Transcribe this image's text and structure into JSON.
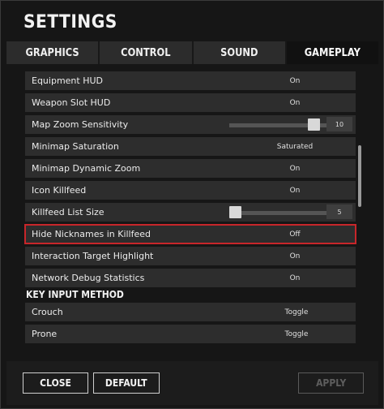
{
  "window": {
    "title": "SETTINGS"
  },
  "tabs": [
    {
      "label": "GRAPHICS",
      "active": false
    },
    {
      "label": "CONTROL",
      "active": false
    },
    {
      "label": "SOUND",
      "active": false
    },
    {
      "label": "GAMEPLAY",
      "active": true
    }
  ],
  "gameplay_settings": [
    {
      "label": "Equipment HUD",
      "value": "On"
    },
    {
      "label": "Weapon Slot HUD",
      "value": "On"
    },
    {
      "label": "Map Zoom Sensitivity",
      "value": "10",
      "slider_fraction": 0.92
    },
    {
      "label": "Minimap Saturation",
      "value": "Saturated"
    },
    {
      "label": "Minimap Dynamic Zoom",
      "value": "On"
    },
    {
      "label": "Icon Killfeed",
      "value": "On"
    },
    {
      "label": "Killfeed List Size",
      "value": "5",
      "slider_fraction": 0.0
    },
    {
      "label": "Hide Nicknames in Killfeed",
      "value": "Off",
      "highlighted": true
    },
    {
      "label": "Interaction Target Highlight",
      "value": "On"
    },
    {
      "label": "Network Debug Statistics",
      "value": "On"
    }
  ],
  "key_input_section": {
    "header": "KEY INPUT METHOD",
    "items": [
      {
        "label": "Crouch",
        "value": "Toggle"
      },
      {
        "label": "Prone",
        "value": "Toggle"
      }
    ]
  },
  "footer": {
    "close_label": "CLOSE",
    "default_label": "DEFAULT",
    "apply_label": "APPLY",
    "apply_enabled": false
  },
  "colors": {
    "highlight_border": "#c8262a",
    "row_background": "#2d2d2d",
    "active_tab": "#111111"
  },
  "icons": {
    "slider_knob": "square-knob",
    "scrollbar": "vertical-scrollbar"
  }
}
